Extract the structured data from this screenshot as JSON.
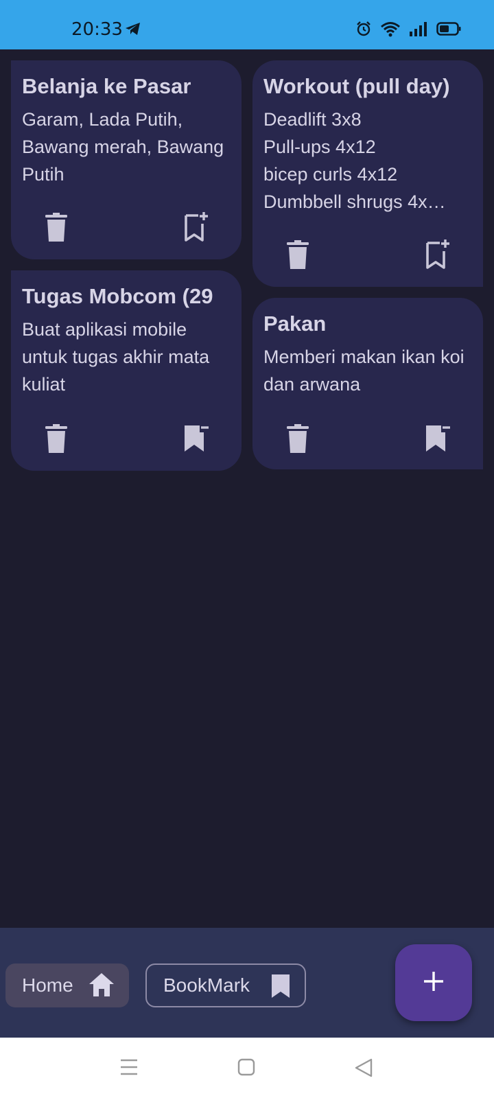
{
  "status_bar": {
    "time": "20:33",
    "icons": [
      "telegram-icon",
      "alarm-icon",
      "wifi-icon",
      "signal-icon",
      "battery-icon"
    ]
  },
  "notes": [
    {
      "title": "Belanja ke Pasar",
      "body": "Garam, Lada Putih,\nBawang merah, Bawang\nPutih",
      "bookmarked": false
    },
    {
      "title": "Workout (pull day)",
      "body": "Deadlift 3x8\nPull-ups 4x12\nbicep curls 4x12\nDumbbell shrugs 4x…",
      "bookmarked": false
    },
    {
      "title": "Tugas Mobcom (29",
      "body": "Buat aplikasi mobile\nuntuk tugas akhir mata\nkuliat",
      "bookmarked": true
    },
    {
      "title": "Pakan",
      "body": "Memberi makan ikan koi\ndan arwana",
      "bookmarked": true
    }
  ],
  "bottom_nav": {
    "home_label": "Home",
    "bookmark_label": "BookMark",
    "fab_icon": "plus-icon"
  },
  "colors": {
    "status_bar": "#35a5ea",
    "background": "#1d1c2e",
    "card": "#28274d",
    "bottom_bar": "#2e3457",
    "fab": "#533a96"
  }
}
